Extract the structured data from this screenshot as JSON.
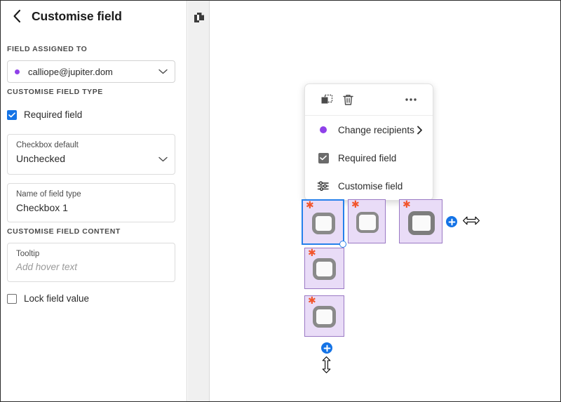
{
  "panel": {
    "title": "Customise field",
    "back_icon": "chevron-left-icon",
    "sections": {
      "assigned_label": "FIELD ASSIGNED TO",
      "type_label": "CUSTOMISE FIELD TYPE",
      "content_label": "CUSTOMISE FIELD CONTENT"
    },
    "assignee": {
      "value": "calliope@jupiter.dom",
      "dot_color": "#8f41e9",
      "chevron_icon": "chevron-down-icon"
    },
    "required_field": {
      "label": "Required field",
      "checked": true,
      "accent": "#1473e6"
    },
    "checkbox_default": {
      "label": "Checkbox default",
      "value": "Unchecked",
      "chevron_icon": "chevron-down-icon"
    },
    "name_of_field_type": {
      "label": "Name of field type",
      "value": "Checkbox 1"
    },
    "tooltip": {
      "label": "Tooltip",
      "placeholder": "Add hover text",
      "value": ""
    },
    "lock_field_value": {
      "label": "Lock field value",
      "checked": false
    }
  },
  "strip": {
    "page_thumbnails_icon": "copy-pages-icon"
  },
  "context_menu": {
    "toolbar": [
      {
        "icon": "duplicate-icon",
        "name": "duplicate-button"
      },
      {
        "icon": "trash-icon",
        "name": "delete-button"
      },
      {
        "icon": "more-options-icon",
        "name": "more-options-button"
      }
    ],
    "items": [
      {
        "label": "Change recipients",
        "icon": "recipient-dot-icon",
        "has_submenu": true,
        "submenu_icon": "chevron-right-icon"
      },
      {
        "label": "Required field",
        "icon": "checkbox-checked-icon",
        "has_submenu": false
      },
      {
        "label": "Customise field",
        "icon": "sliders-icon",
        "has_submenu": false
      }
    ]
  },
  "canvas": {
    "fields": [
      {
        "name": "checkbox-field-1",
        "required": true,
        "selected": true
      },
      {
        "name": "checkbox-field-2",
        "required": true,
        "selected": false
      },
      {
        "name": "checkbox-field-3",
        "required": true,
        "selected": false
      },
      {
        "name": "checkbox-field-4",
        "required": true,
        "selected": false
      },
      {
        "name": "checkbox-field-5",
        "required": true,
        "selected": false
      }
    ],
    "add_right_button": "add-field-right-button",
    "add_below_button": "add-field-below-button",
    "resize_horizontal_cursor": "resize-horizontal-cursor",
    "resize_vertical_cursor": "resize-vertical-cursor",
    "required_marker": "*",
    "required_marker_color": "#f2552c",
    "field_fill": "#e9dcf7",
    "field_border": "#9a79c4",
    "selection_color": "#2680eb"
  }
}
